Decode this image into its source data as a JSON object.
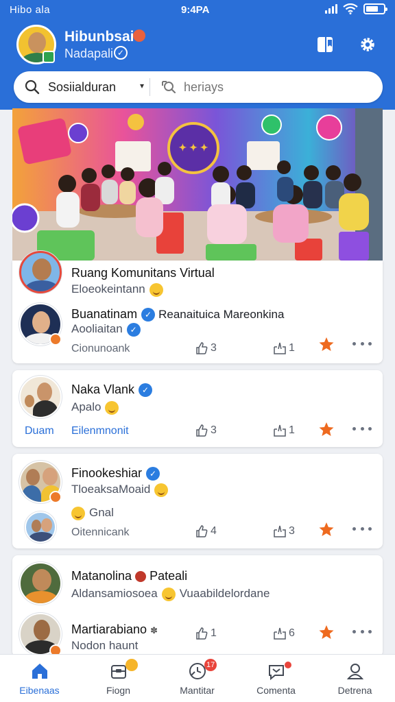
{
  "status_bar": {
    "carrier": "Hibo ala",
    "time": "9:4PA"
  },
  "profile": {
    "name": "Hibunbsai",
    "subtitle": "Nadapali"
  },
  "search": {
    "left_label": "Sosiialduran",
    "placeholder": "heriays"
  },
  "posts": [
    {
      "title": "Ruang Komunitans Virtual",
      "subtitle": "Eloeokeintann",
      "reply_name": "Buanatinam",
      "reply_text": "Reanaituica Mareonkina",
      "reply_sub": "Aooliaitan",
      "footer_left": "Cionunoank",
      "likes": "3",
      "shares": "1"
    },
    {
      "title": "Naka Vlank",
      "subtitle": "Apalo",
      "footer_left": "Duam",
      "footer_link": "Eilenmnonit",
      "likes": "3",
      "shares": "1"
    },
    {
      "title": "Finookeshiar",
      "subtitle": "TloeaksaMoaid",
      "reply_text": "Gnal",
      "footer_left": "Oitennicank",
      "likes": "4",
      "shares": "3"
    },
    {
      "title": "Matanolina",
      "title_suffix": "Pateali",
      "subtitle": "Aldansamiosoea",
      "subtitle_suffix": "Vuaabildelordane",
      "reply_name": "Martiarabiano",
      "reply_sub": "Nodon haunt",
      "likes": "1",
      "shares": "6"
    }
  ],
  "nav": [
    {
      "label": "Eibenaas",
      "active": true
    },
    {
      "label": "Fiogn",
      "badge": ""
    },
    {
      "label": "Mantitar",
      "badge": "17"
    },
    {
      "label": "Comenta",
      "badge": ""
    },
    {
      "label": "Detrena"
    }
  ],
  "colors": {
    "primary": "#2a6fd8",
    "star": "#ee6a1f",
    "verified": "#2b7de0"
  }
}
